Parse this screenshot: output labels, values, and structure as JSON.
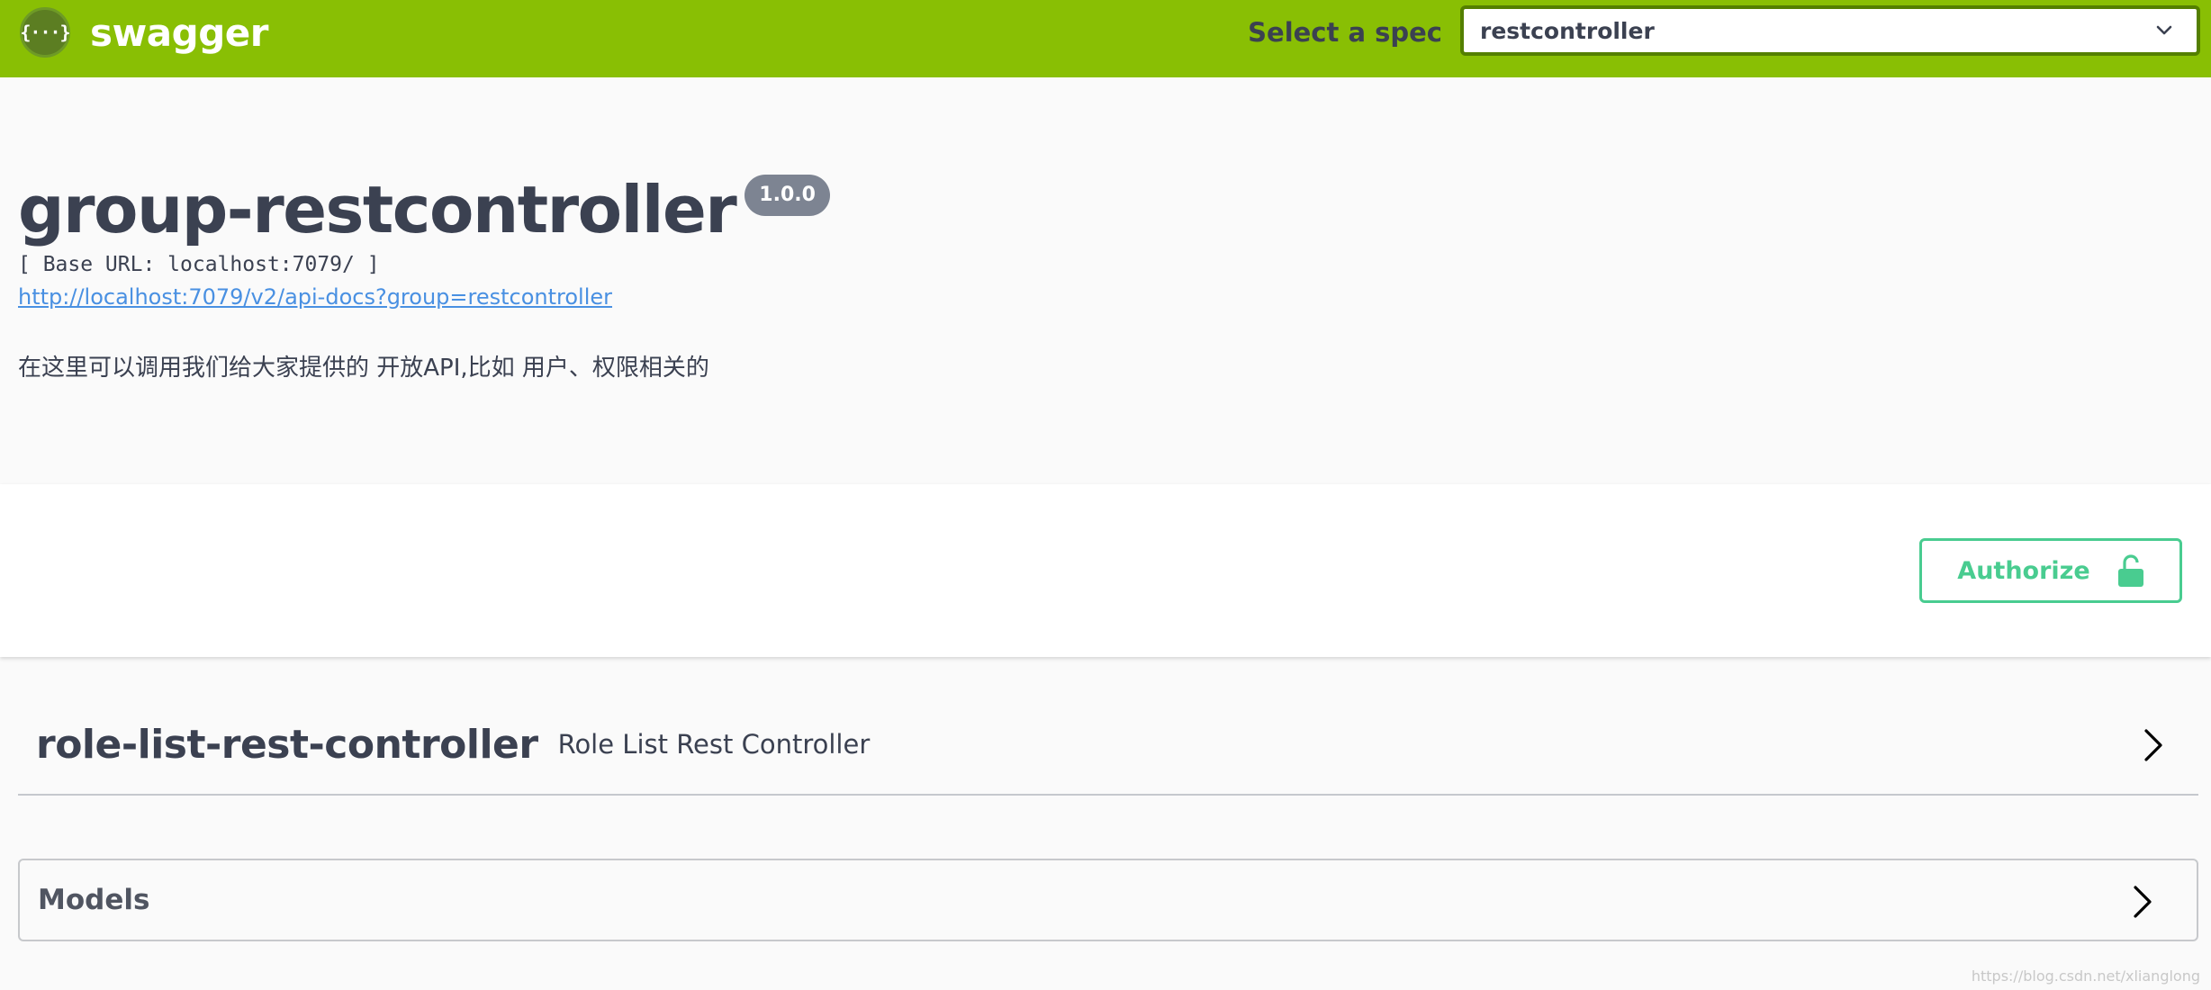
{
  "topbar": {
    "logo_glyph": "{···}",
    "brand": "swagger",
    "spec_label": "Select a spec",
    "spec_selected": "restcontroller",
    "bg_color": "#89bf04"
  },
  "info": {
    "title": "group-restcontroller",
    "version": "1.0.0",
    "base_url": "[ Base URL: localhost:7079/ ]",
    "spec_link": "http://localhost:7079/v2/api-docs?group=restcontroller",
    "description": "在这里可以调用我们给大家提供的 开放API,比如 用户、权限相关的"
  },
  "auth": {
    "button_label": "Authorize",
    "icon": "unlock-icon",
    "color": "#49cc90"
  },
  "tags": [
    {
      "name": "role-list-rest-controller",
      "description": "Role List Rest Controller",
      "icon": "chevron-right-icon"
    }
  ],
  "models": {
    "title": "Models",
    "icon": "chevron-right-icon"
  },
  "watermark": "https://blog.csdn.net/xlianglong"
}
